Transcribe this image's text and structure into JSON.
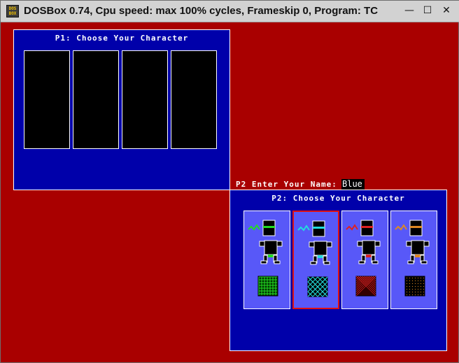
{
  "window": {
    "title": "DOSBox 0.74, Cpu speed: max 100% cycles, Frameskip  0, Program:     TC",
    "app_icon_text": "DOS BOX",
    "minimize": "—",
    "maximize": "☐",
    "close": "✕"
  },
  "game": {
    "p1": {
      "title": "P1: Choose Your Character",
      "slot_count": 4
    },
    "p2": {
      "name_prompt": "P2 Enter Your Name:",
      "name_value": "Blue",
      "title": "P2: Choose Your Character",
      "selected_index": 1,
      "characters": [
        {
          "accent": "#22dd22",
          "pattern": "grid"
        },
        {
          "accent": "#22dddd",
          "pattern": "diagonal-cross"
        },
        {
          "accent": "#dd2222",
          "pattern": "dense-cross"
        },
        {
          "accent": "#dd8822",
          "pattern": "dots"
        }
      ]
    }
  },
  "colors": {
    "background": "#a90000",
    "panel": "#0000aa",
    "card": "#5858f8"
  }
}
